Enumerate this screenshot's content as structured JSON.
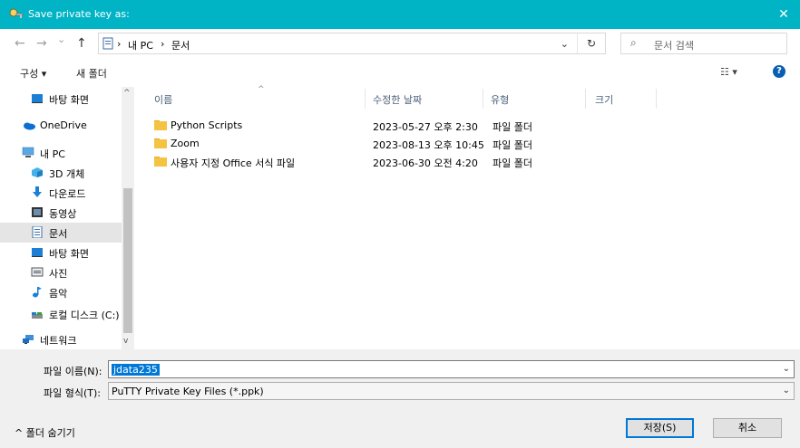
{
  "titlebar": {
    "title": "Save private key as:",
    "close": "✕"
  },
  "nav": {
    "back": "←",
    "forward": "→",
    "history": "⌄",
    "up": "↑",
    "breadcrumb": [
      "내 PC",
      "문서"
    ],
    "separators": [
      "›",
      "›"
    ],
    "dropdown": "⌄",
    "refresh": "↻",
    "search_placeholder": "문서 검색",
    "search_icon": "⌕"
  },
  "toolbar": {
    "organize": "구성 ▾",
    "new_folder": "새 폴더",
    "view": "☷ ▾",
    "help": "?"
  },
  "sidebar": {
    "items": [
      {
        "label": "바탕 화면",
        "icon": "desktop-icon"
      },
      {
        "label": "OneDrive",
        "icon": "cloud-icon"
      },
      {
        "label": "내 PC",
        "icon": "pc-icon"
      },
      {
        "label": "3D 개체",
        "icon": "cube-icon"
      },
      {
        "label": "다운로드",
        "icon": "download-icon"
      },
      {
        "label": "동영상",
        "icon": "video-icon"
      },
      {
        "label": "문서",
        "icon": "document-icon"
      },
      {
        "label": "바탕 화면",
        "icon": "desktop-icon"
      },
      {
        "label": "사진",
        "icon": "picture-icon"
      },
      {
        "label": "음악",
        "icon": "music-icon"
      },
      {
        "label": "로컬 디스크 (C:)",
        "icon": "disk-icon"
      },
      {
        "label": "네트워크",
        "icon": "network-icon"
      }
    ],
    "scroll_up": "^",
    "scroll_down": "v"
  },
  "columns": {
    "name": "이름",
    "modified": "수정한 날짜",
    "type": "유형",
    "size": "크기",
    "sort_indicator": "^"
  },
  "files": [
    {
      "name": "Python Scripts",
      "modified": "2023-05-27 오후 2:30",
      "type": "파일 폴더"
    },
    {
      "name": "Zoom",
      "modified": "2023-08-13 오후 10:45",
      "type": "파일 폴더"
    },
    {
      "name": "사용자 지정 Office 서식 파일",
      "modified": "2023-06-30 오전 4:20",
      "type": "파일 폴더"
    }
  ],
  "form": {
    "filename_label": "파일 이름(N):",
    "filename_value": "jdata235",
    "filetype_label": "파일 형식(T):",
    "filetype_value": "PuTTY Private Key Files (*.ppk)",
    "dropdown": "⌄"
  },
  "buttons": {
    "hide_folders": "^ 폴더 숨기기",
    "save": "저장(S)",
    "cancel": "취소"
  },
  "colors": {
    "title_bg": "#00b4c6",
    "folder": "#f5c342",
    "accent": "#0078d7"
  }
}
